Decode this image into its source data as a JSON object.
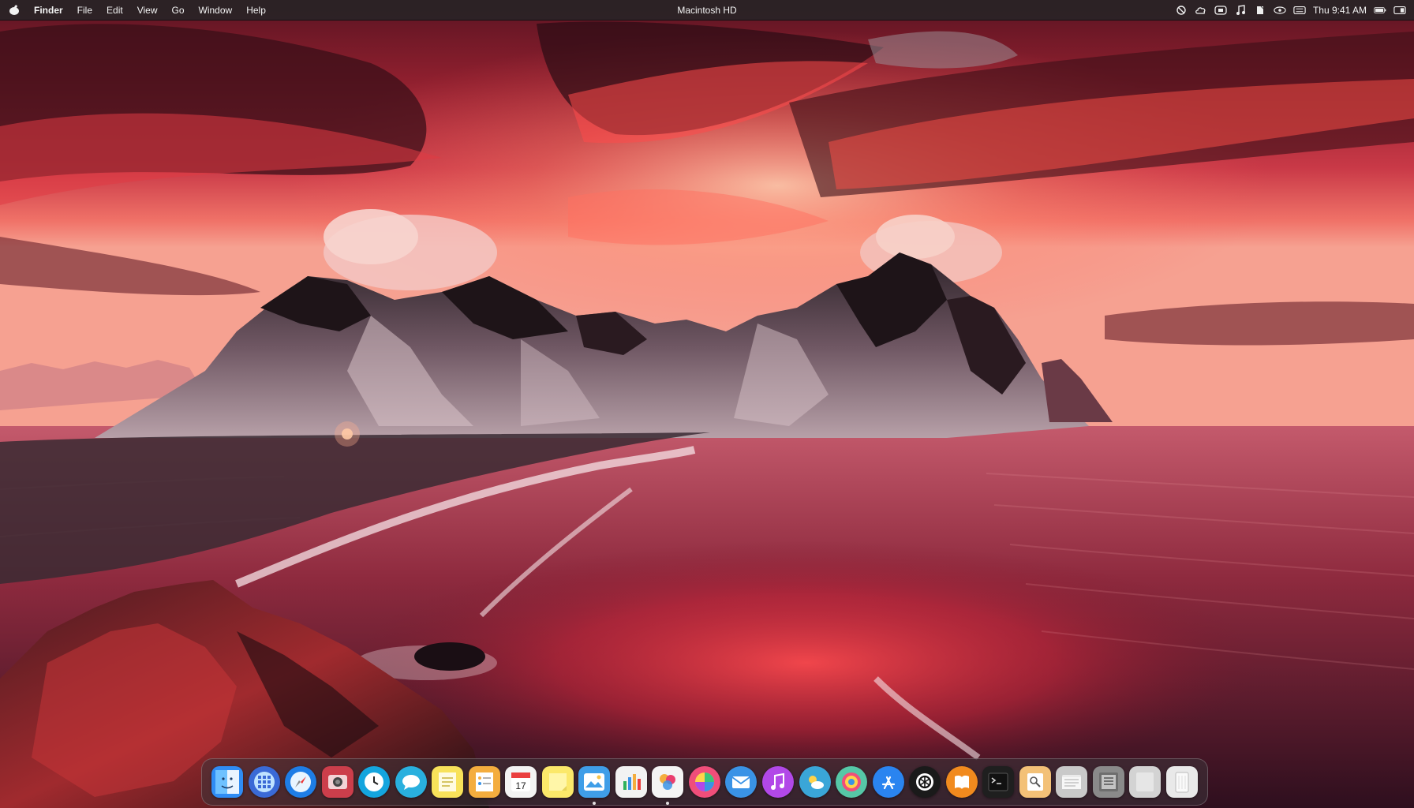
{
  "menubar": {
    "app_name": "Finder",
    "items": [
      "File",
      "Edit",
      "View",
      "Go",
      "Window",
      "Help"
    ],
    "window_title": "Macintosh HD",
    "clock": "Thu 9:41 AM",
    "status_icons": [
      "screen-record-icon",
      "cloud-icon",
      "display-icon",
      "music-icon",
      "notes-icon",
      "eye-icon",
      "battery-icon"
    ]
  },
  "dock": {
    "items": [
      {
        "name": "finder",
        "icon": "finder-icon",
        "bg": "#2f8cf4",
        "running": false
      },
      {
        "name": "launchpad",
        "icon": "launchpad-icon",
        "bg": "#3a6ad6",
        "running": false
      },
      {
        "name": "safari",
        "icon": "safari-icon",
        "bg": "#1e7de6",
        "running": false
      },
      {
        "name": "photo-booth",
        "icon": "photo-booth-icon",
        "bg": "#cc3e4b",
        "running": false
      },
      {
        "name": "clock",
        "icon": "clock-icon",
        "bg": "#14a5de",
        "running": false
      },
      {
        "name": "messages",
        "icon": "messages-icon",
        "bg": "#29b0de",
        "running": false
      },
      {
        "name": "notes",
        "icon": "notes-icon",
        "bg": "#f8e25a",
        "running": false
      },
      {
        "name": "reminders",
        "icon": "reminders-icon",
        "bg": "#f4ad3e",
        "running": false
      },
      {
        "name": "calendar",
        "icon": "calendar-icon",
        "bg": "#f3f3f3",
        "running": false
      },
      {
        "name": "stickies",
        "icon": "stickies-icon",
        "bg": "#fbe86a",
        "running": false
      },
      {
        "name": "photos",
        "icon": "photos-icon",
        "bg": "#3f9ee8",
        "running": true
      },
      {
        "name": "numbers",
        "icon": "numbers-icon",
        "bg": "#f2f2f2",
        "running": false
      },
      {
        "name": "pages",
        "icon": "pages-icon",
        "bg": "#f4f4f4",
        "running": true
      },
      {
        "name": "color-picker",
        "icon": "color-wheel-icon",
        "bg": "#f04e7a",
        "running": false
      },
      {
        "name": "mail",
        "icon": "mail-icon",
        "bg": "#3a93e6",
        "running": false
      },
      {
        "name": "music",
        "icon": "music-icon",
        "bg": "#b248e8",
        "running": false
      },
      {
        "name": "weather",
        "icon": "weather-icon",
        "bg": "#3aa6d8",
        "running": false
      },
      {
        "name": "color-sync",
        "icon": "color-sync-icon",
        "bg": "#56c7a7",
        "running": false
      },
      {
        "name": "app-store",
        "icon": "app-store-icon",
        "bg": "#2a84f0",
        "running": false
      },
      {
        "name": "openai",
        "icon": "openai-icon",
        "bg": "#1a1a1a",
        "running": false
      },
      {
        "name": "books",
        "icon": "books-icon",
        "bg": "#f18a1e",
        "running": false
      },
      {
        "name": "terminal",
        "icon": "terminal-icon",
        "bg": "#1f1f1f",
        "running": false
      },
      {
        "name": "preview",
        "icon": "preview-icon",
        "bg": "#f3c177",
        "running": false
      },
      {
        "name": "documents-folder",
        "icon": "folder-icon",
        "bg": "#c9c9c9",
        "running": false
      },
      {
        "name": "downloads-stack",
        "icon": "downloads-icon",
        "bg": "#8a8a8a",
        "running": false
      },
      {
        "name": "document-stack",
        "icon": "document-icon",
        "bg": "#d3d3d3",
        "running": false
      },
      {
        "name": "trash",
        "icon": "trash-icon",
        "bg": "#e9e9e9",
        "running": false
      }
    ]
  }
}
